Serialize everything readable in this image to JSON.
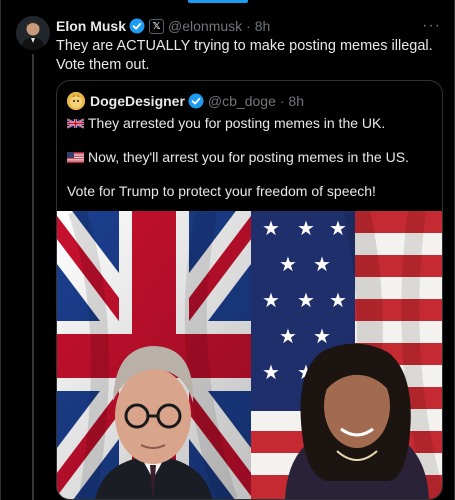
{
  "tweet": {
    "author_name": "Elon Musk",
    "author_handle": "@elonmusk",
    "time": "· 8h",
    "text": "They are ACTUALLY trying to make posting memes illegal. Vote them out.",
    "more_icon": "ellipsis-icon"
  },
  "quote": {
    "author_name": "DogeDesigner",
    "author_handle": "@cb_doge",
    "time": "· 8h",
    "line1": "They arrested you for posting memes in the UK.",
    "line2": "Now, they'll arrest you for posting memes in the US.",
    "line3": "Vote for Trump to protect your freedom of speech!",
    "flag1": "uk-flag-icon",
    "flag2": "us-flag-icon"
  },
  "colors": {
    "background": "#000000",
    "text": "#e7e9ea",
    "muted": "#71767b",
    "border": "#2f3336",
    "verified": "#1d9bf0",
    "accent": "#1d9bf0"
  }
}
